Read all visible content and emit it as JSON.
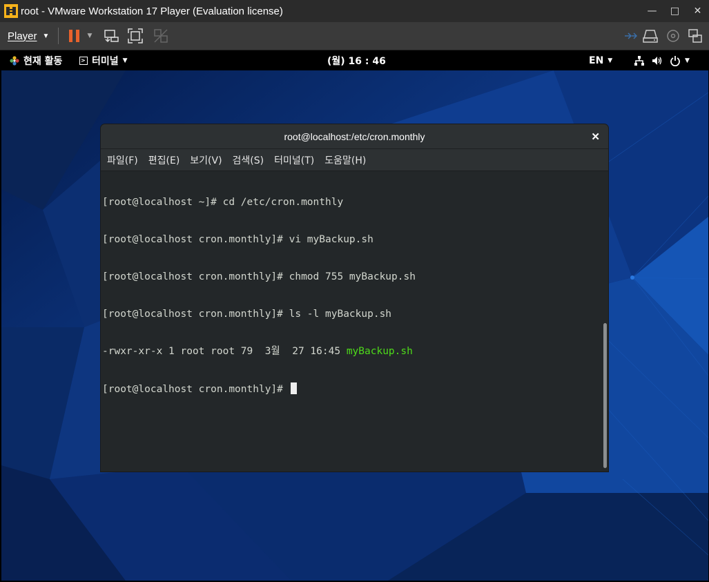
{
  "vmware": {
    "title": "root - VMware Workstation 17 Player (Evaluation license)",
    "player_menu": "Player",
    "colors": {
      "pause_icon": "#e8622c",
      "logo": "#f6b21b"
    }
  },
  "gnome_bar": {
    "activities": "현재 활동",
    "app_menu": "터미널",
    "clock": "(월) 16 : 46",
    "language": "EN"
  },
  "terminal": {
    "title": "root@localhost:/etc/cron.monthly",
    "menu": [
      "파일(F)",
      "편집(E)",
      "보기(V)",
      "검색(S)",
      "터미널(T)",
      "도움말(H)"
    ],
    "lines": [
      "[root@localhost ~]# cd /etc/cron.monthly",
      "[root@localhost cron.monthly]# vi myBackup.sh",
      "[root@localhost cron.monthly]# chmod 755 myBackup.sh",
      "[root@localhost cron.monthly]# ls -l myBackup.sh"
    ],
    "ls_output_prefix": "-rwxr-xr-x 1 root root 79  3월  27 16:45 ",
    "ls_output_file": "myBackup.sh",
    "prompt": "[root@localhost cron.monthly]# "
  }
}
